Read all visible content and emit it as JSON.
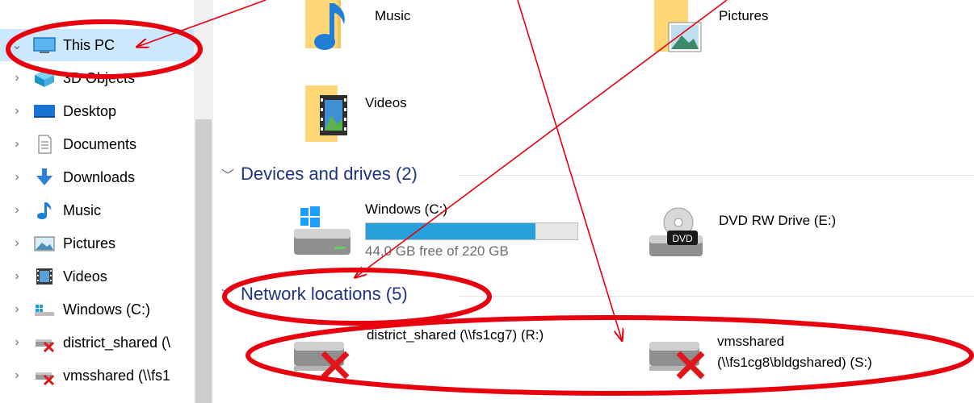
{
  "sidebar": {
    "items": [
      {
        "label": "This PC",
        "icon": "monitor-icon",
        "selected": true
      },
      {
        "label": "3D Objects",
        "icon": "3d-objects-icon"
      },
      {
        "label": "Desktop",
        "icon": "desktop-icon"
      },
      {
        "label": "Documents",
        "icon": "documents-icon"
      },
      {
        "label": "Downloads",
        "icon": "downloads-icon"
      },
      {
        "label": "Music",
        "icon": "music-note-icon"
      },
      {
        "label": "Pictures",
        "icon": "pictures-icon"
      },
      {
        "label": "Videos",
        "icon": "videos-icon"
      },
      {
        "label": "Windows (C:)",
        "icon": "drive-icon"
      },
      {
        "label": "district_shared (\\",
        "icon": "disconnected-network-drive-icon"
      },
      {
        "label": "vmsshared (\\\\fs1",
        "icon": "disconnected-network-drive-icon"
      }
    ]
  },
  "folders": [
    {
      "label": "Music",
      "icon": "music-folder-icon"
    },
    {
      "label": "Pictures",
      "icon": "pictures-folder-icon"
    },
    {
      "label": "Videos",
      "icon": "videos-folder-icon"
    }
  ],
  "devices": {
    "header": "Devices and drives (2)",
    "items": [
      {
        "name": "Windows (C:)",
        "free": "44.0 GB free of 220 GB",
        "used_fraction": 0.8,
        "icon": "windows-drive-icon"
      },
      {
        "name": "DVD RW Drive (E:)",
        "icon": "dvd-drive-icon",
        "badge": "DVD"
      }
    ]
  },
  "network": {
    "header": "Network locations (5)",
    "items": [
      {
        "name": "district_shared (\\\\fs1cg7) (R:)",
        "icon": "disconnected-network-drive-icon"
      },
      {
        "name": "vmsshared",
        "path": "(\\\\fs1cg8\\bldgshared) (S:)",
        "icon": "disconnected-network-drive-icon"
      }
    ]
  },
  "colors": {
    "selection": "#cce8ff",
    "header": "#1e3287",
    "bar_fill": "#26a0da",
    "annotation": "#e8000f"
  }
}
